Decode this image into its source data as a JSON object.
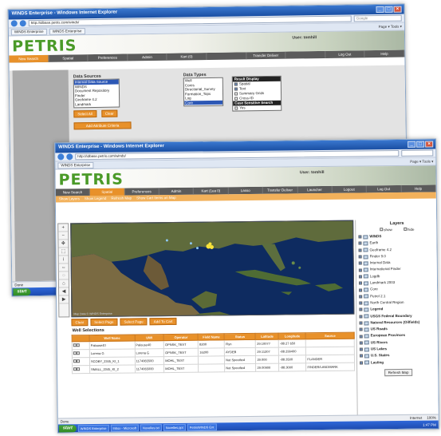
{
  "back_window": {
    "title": "WINDS Enterprise - Windows Internet Explorer",
    "url": "http://idbase.petris.com/winds/",
    "search_placeholder": "Google",
    "tab1": "WINDS Enterprise",
    "tab2": "WINDS Enterprise",
    "tools_label": "Page ▾  Tools ▾",
    "logo": "PETRIS",
    "user": "User: tomhill",
    "nav": [
      "New Search",
      "Spatial",
      "Preferences",
      "Admin",
      "Kart (0)",
      "",
      "Transfer Deliver",
      "",
      "Log Out",
      "Help"
    ],
    "data_sources_label": "Data Sources",
    "data_sources": [
      "Internal Data Source",
      "WINDS",
      "Document Repository",
      "Finder",
      "Geoframe 4.2",
      "Landmark"
    ],
    "select_all": "Select All",
    "clear": "Clear",
    "data_types_label": "Data Types",
    "data_types": [
      "Well",
      "Cores",
      "Directional_Survey",
      "Formation_Tops",
      "Log",
      "Core"
    ],
    "result_display_header": "Result Display",
    "result_options": [
      "Spatial",
      "Text",
      "Summary Grids",
      "Cross-ID"
    ],
    "case_sensitive_header": "Case Sensitive Search",
    "case_option": "Yes",
    "advanced_link": "Add Attribute Criteria",
    "status_done": "Done"
  },
  "front_window": {
    "title": "WINDS Enterprise - Windows Internet Explorer",
    "url": "http://idbase.petris.com/winds/",
    "tab": "WINDS Enterprise",
    "tools_label": "Page ▾  Tools ▾",
    "logo": "PETRIS",
    "user": "User: tomhill",
    "nav": [
      "New Search",
      "Spatial",
      "Preferences",
      "Admin",
      "Kart (1ea 0)",
      "Lasso",
      "Transfer Deliver",
      "Launcher",
      "Logout",
      "Log Out",
      "Help"
    ],
    "subnav": [
      "Show Layers",
      "Show Legend",
      "Refresh Map",
      "Show Cart Items on Map"
    ],
    "map_credit": "Map Data © WINDS Enterprise",
    "map_buttons": [
      "Clear",
      "Select Page",
      "Select Page",
      "Add To Cart"
    ],
    "well_selections_label": "Well Selections",
    "layers_title": "Layers",
    "layers_toggle": [
      "show",
      "hide"
    ],
    "layers": [
      {
        "label": "WINDS",
        "bold": true
      },
      {
        "label": "Earth",
        "bold": false
      },
      {
        "label": "Geoframe 4.2",
        "bold": false
      },
      {
        "label": "Finder 9.0",
        "bold": false
      },
      {
        "label": "Internal Data",
        "bold": false
      },
      {
        "label": "International Finder",
        "bold": false
      },
      {
        "label": "Logdb",
        "bold": false
      },
      {
        "label": "Landmark 2003",
        "bold": false
      },
      {
        "label": "Core",
        "bold": false
      },
      {
        "label": "Petrel 2.1",
        "bold": false
      },
      {
        "label": "North Central Region",
        "bold": false
      },
      {
        "label": "Legend",
        "bold": true
      },
      {
        "label": "USGS Federal Boundary",
        "bold": true
      },
      {
        "label": "Natural Resources (Oilfields)",
        "bold": true
      },
      {
        "label": "US Roads",
        "bold": true
      },
      {
        "label": "European Provinces",
        "bold": true
      },
      {
        "label": "US Rivers",
        "bold": true
      },
      {
        "label": "US Lakes",
        "bold": true
      },
      {
        "label": "U.S. States",
        "bold": true
      },
      {
        "label": "Lasting",
        "bold": true
      }
    ],
    "refresh_label": "Refresh Map",
    "grid_headers": [
      "",
      "Well Name",
      "UWI",
      "Operator",
      "Field Name",
      "Status",
      "Latitude",
      "Longitude",
      "Source"
    ],
    "grid_rows": [
      [
        "Palouse40",
        "Palouse40",
        "OPNSK_TEST",
        "8200",
        "Flyn",
        "29.10077",
        "-88.27 650",
        ""
      ],
      [
        "Lorena G",
        "Lorena G",
        "OPNSK_TEST",
        "16200",
        "AYDEB",
        "29.11207",
        "-88.299400",
        ""
      ],
      [
        "SCOBY_2345_KI_1",
        "1174065500",
        "MOHL_TEST",
        "",
        "Not Specified",
        "29.000",
        "-88.3500",
        "FLANDER"
      ],
      [
        "SMALL_2345_KI_2",
        "1174065000",
        "MOHL_TEST",
        "",
        "Not Specified",
        "29.00900",
        "-88.3000",
        "FINDER/LANDMARK"
      ]
    ],
    "status_left": "Done",
    "status_right": "Internet",
    "zoom": "100%"
  },
  "taskbar": {
    "start": "start",
    "items": [
      "WINDS Enterprise",
      "Inbox - Microsoft",
      "Novelles.txt",
      "Novelles.ppt",
      "PetrisWINDS Ent"
    ],
    "clock": "1:47 PM"
  }
}
